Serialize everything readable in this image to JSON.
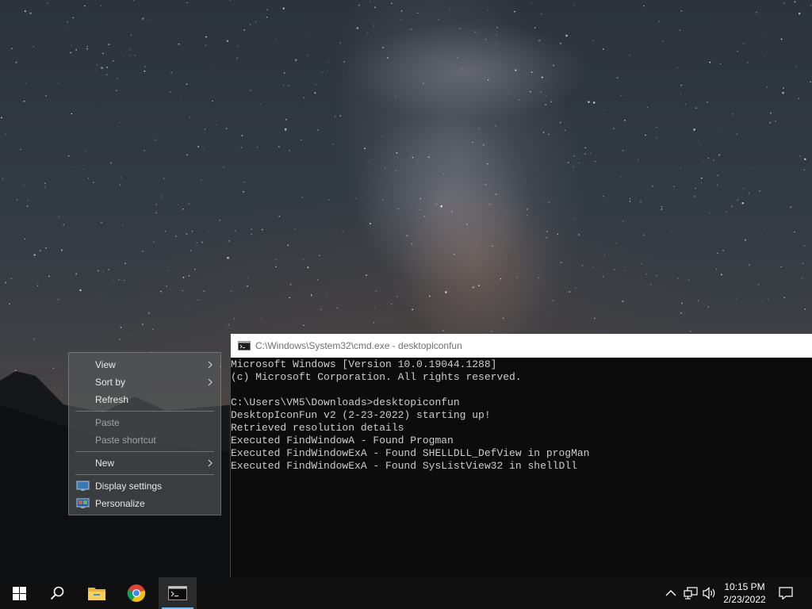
{
  "context_menu": {
    "items": [
      {
        "label": "View",
        "enabled": true,
        "submenu": true
      },
      {
        "label": "Sort by",
        "enabled": true,
        "submenu": true
      },
      {
        "label": "Refresh",
        "enabled": true,
        "submenu": false
      },
      {
        "label": "Paste",
        "enabled": false,
        "submenu": false
      },
      {
        "label": "Paste shortcut",
        "enabled": false,
        "submenu": false
      },
      {
        "label": "New",
        "enabled": true,
        "submenu": true
      },
      {
        "label": "Display settings",
        "enabled": true,
        "submenu": false,
        "icon": "display-settings-icon"
      },
      {
        "label": "Personalize",
        "enabled": true,
        "submenu": false,
        "icon": "personalize-icon"
      }
    ]
  },
  "cmd": {
    "title": "C:\\Windows\\System32\\cmd.exe - desktopiconfun",
    "lines": [
      "Microsoft Windows [Version 10.0.19044.1288]",
      "(c) Microsoft Corporation. All rights reserved.",
      "",
      "C:\\Users\\VM5\\Downloads>desktopiconfun",
      "DesktopIconFun v2 (2-23-2022) starting up!",
      "Retrieved resolution details",
      "Executed FindWindowA - Found Progman",
      "Executed FindWindowExA - Found SHELLDLL_DefView in progMan",
      "Executed FindWindowExA - Found SysListView32 in shellDll"
    ]
  },
  "taskbar": {
    "buttons": [
      "windows-start-icon",
      "search-icon",
      "file-explorer-icon",
      "chrome-icon",
      "command-prompt-icon"
    ],
    "tray_icons": [
      "chevron-up-icon",
      "network-icon",
      "volume-icon"
    ],
    "clock": {
      "time": "10:15 PM",
      "date": "2/23/2022"
    },
    "notification_icon": "notification-icon",
    "colors": {
      "background": "#101010",
      "active_underline": "#76b9ed"
    }
  }
}
